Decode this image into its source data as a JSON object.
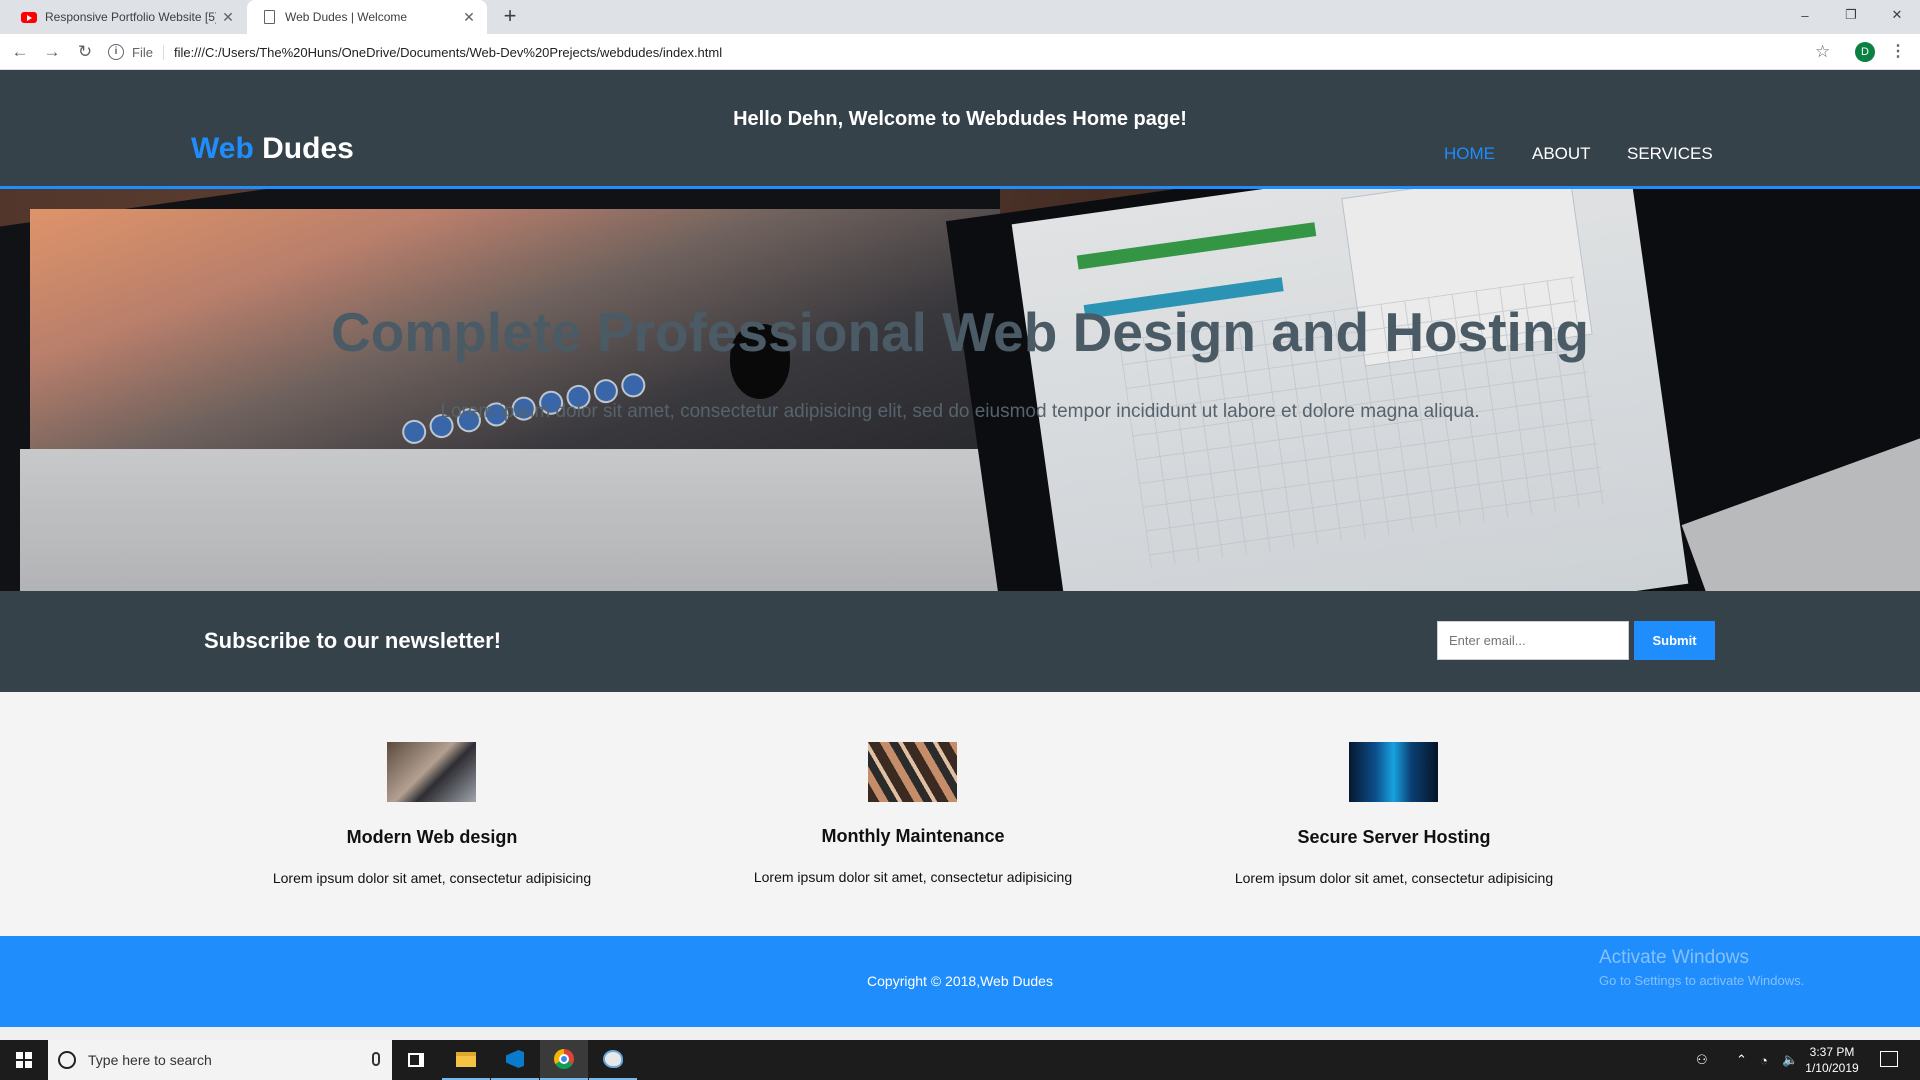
{
  "browser": {
    "tabs": [
      {
        "title": "Responsive Portfolio Website [5]",
        "icon": "youtube-icon",
        "active": false
      },
      {
        "title": "Web Dudes | Welcome",
        "icon": "document-icon",
        "active": true
      }
    ],
    "new_tab": "+",
    "window_controls": {
      "minimize": "–",
      "maximize": "❐",
      "close": "✕"
    },
    "nav": {
      "back": "←",
      "forward": "→",
      "reload": "↻"
    },
    "url_scheme": "File",
    "url": "file:///C:/Users/The%20Huns/OneDrive/Documents/Web-Dev%20Prejects/webdudes/index.html",
    "bookmark": "☆",
    "profile_initial": "D",
    "menu": "⋮"
  },
  "header": {
    "greeting": "Hello Dehn, Welcome to Webdudes Home page!",
    "logo_highlight": "Web",
    "logo_rest": " Dudes",
    "nav": [
      "HOME",
      "ABOUT",
      "SERVICES"
    ],
    "current_nav": "HOME"
  },
  "hero": {
    "title": "Complete Professional Web Design and Hosting",
    "text": "Lorem ipsum dolor sit amet, consectetur adipisicing elit, sed do eiusmod tempor incididunt ut labore et dolore magna aliqua."
  },
  "newsletter": {
    "heading": "Subscribe to our newsletter!",
    "email_placeholder": "Enter email...",
    "submit_label": "Submit"
  },
  "boxes": [
    {
      "title": "Modern Web design",
      "text": "Lorem ipsum dolor sit amet, consectetur adipisicing"
    },
    {
      "title": "Monthly Maintenance",
      "text": "Lorem ipsum dolor sit amet, consectetur adipisicing"
    },
    {
      "title": "Secure Server Hosting",
      "text": "Lorem ipsum dolor sit amet, consectetur adipisicing"
    }
  ],
  "footer": {
    "copyright": "Copyright © 2018,Web Dudes"
  },
  "watermark": {
    "line1": "Activate Windows",
    "line2": "Go to Settings to activate Windows."
  },
  "taskbar": {
    "search_placeholder": "Type here to search",
    "time": "3:37 PM",
    "date": "1/10/2019",
    "apps": [
      "task-view-icon",
      "file-explorer-icon",
      "vscode-icon",
      "chrome-icon",
      "paint-icon"
    ]
  },
  "colors": {
    "header_bg": "#35424a",
    "accent": "#1f8dfc",
    "boxes_bg": "#f4f4f4"
  }
}
